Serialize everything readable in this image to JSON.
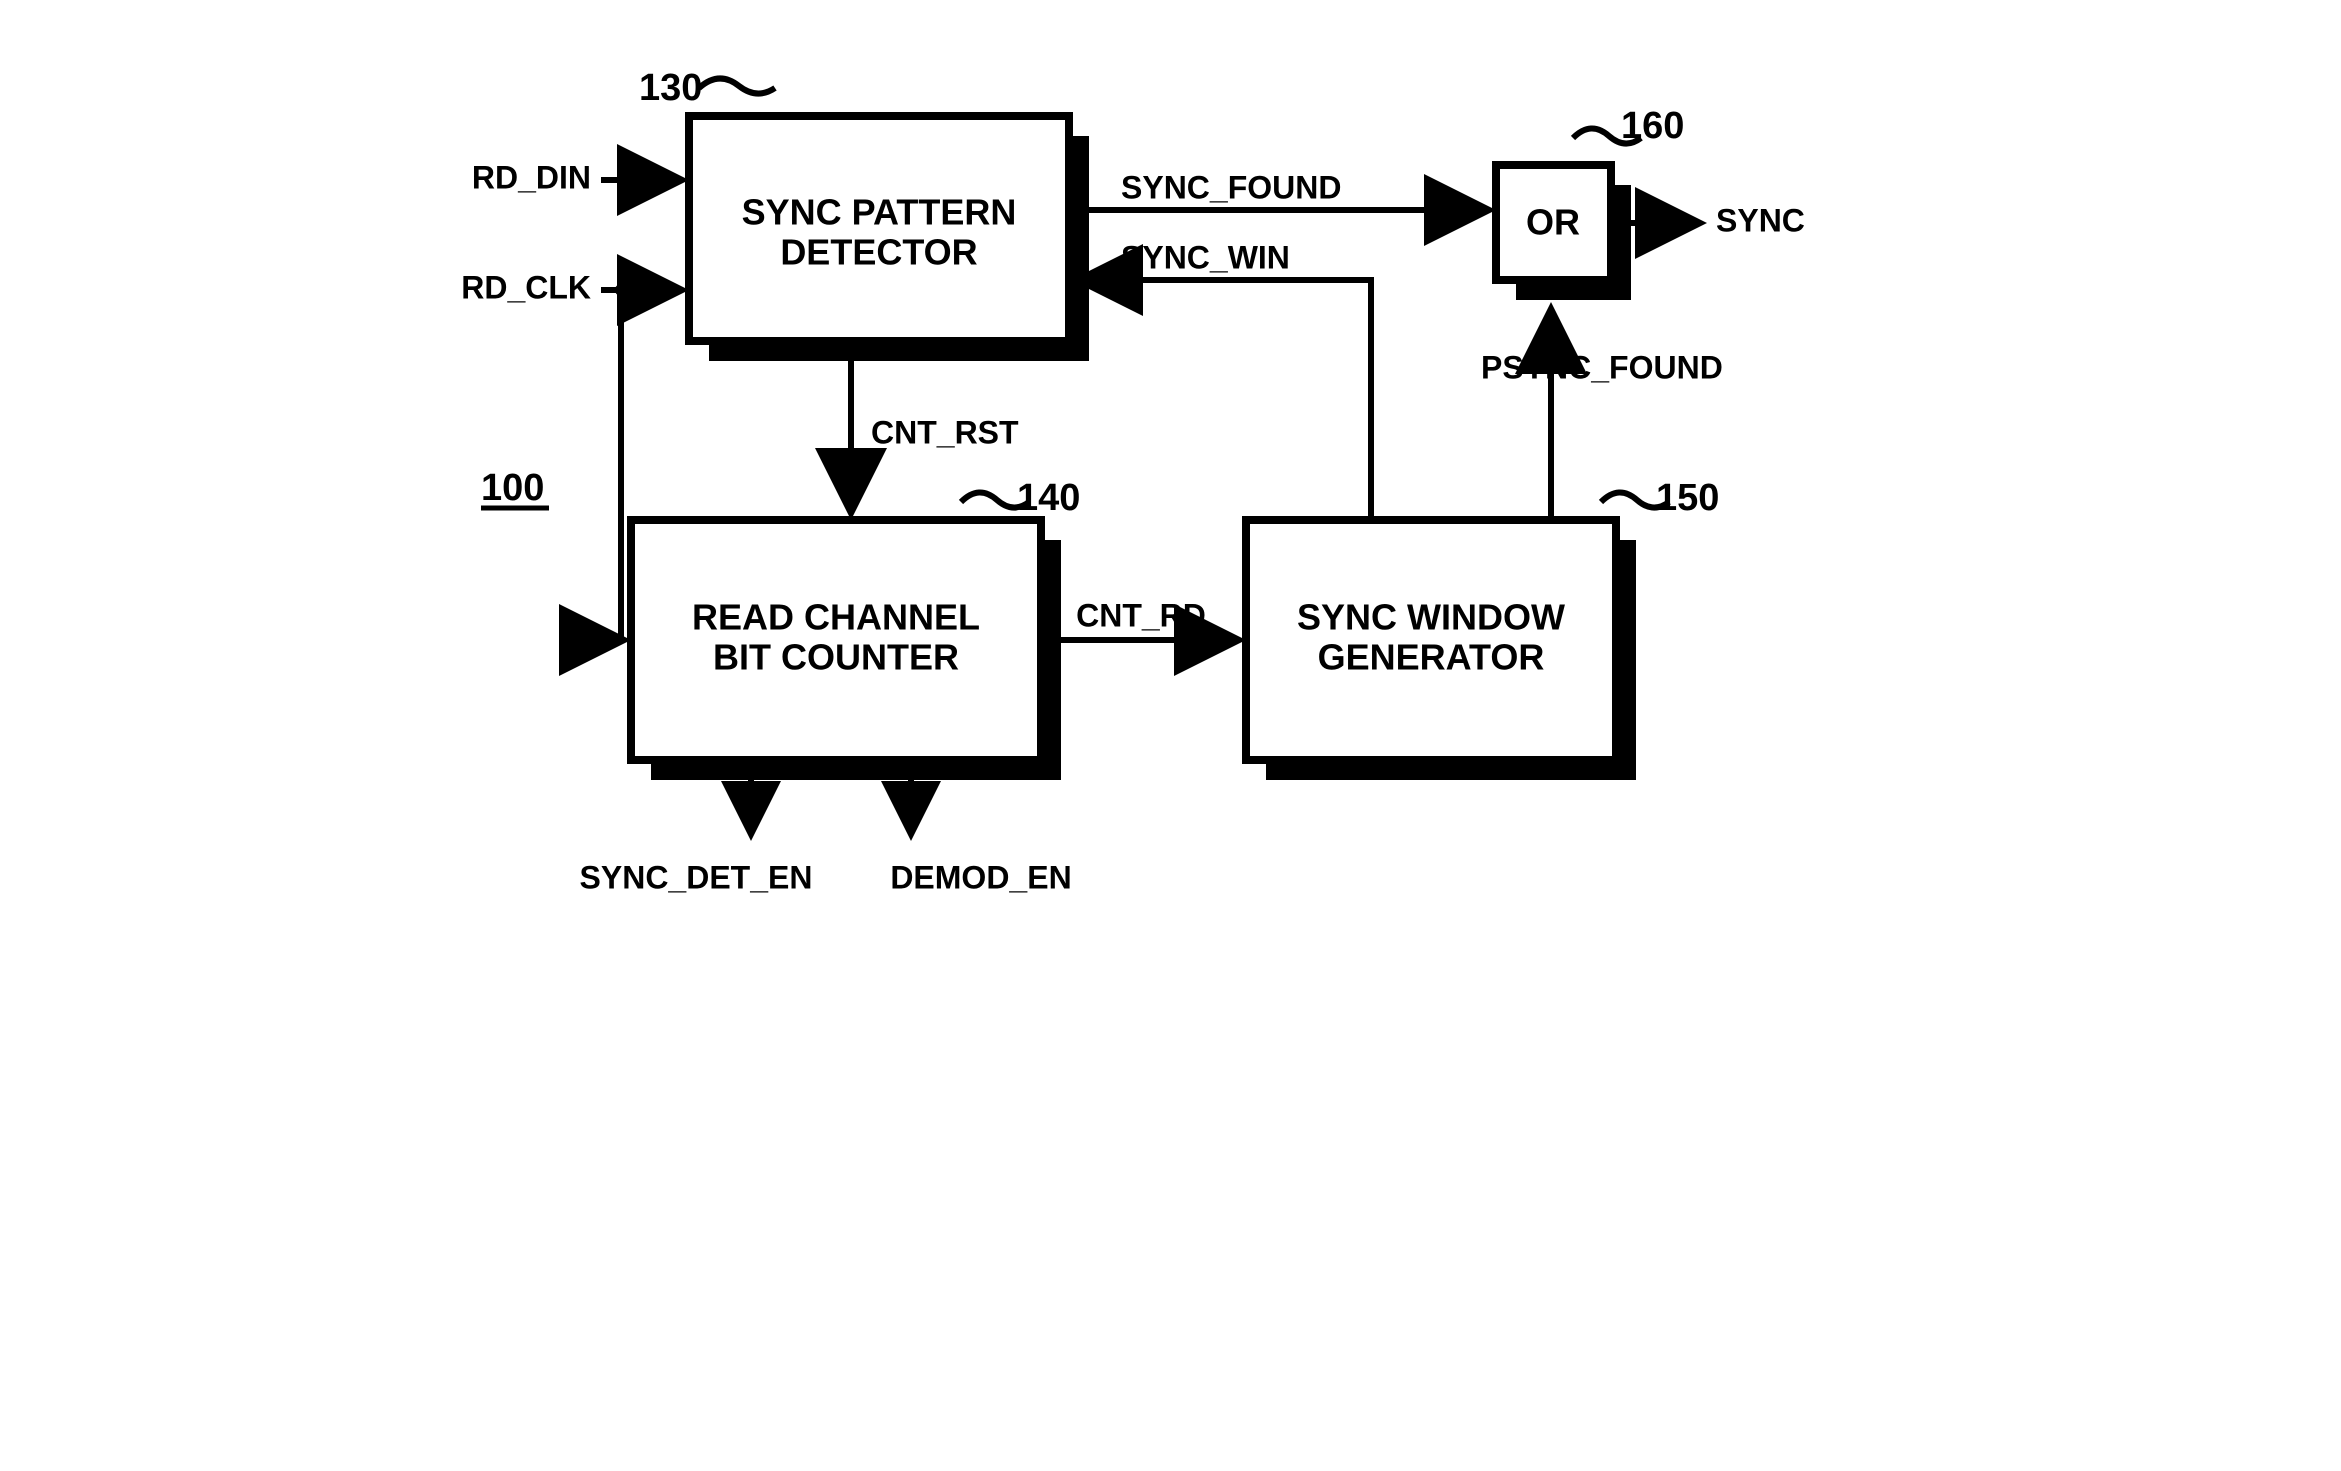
{
  "ref": {
    "fig": "100",
    "spd": "130",
    "rcbc": "140",
    "swg": "150",
    "org": "160"
  },
  "block": {
    "spd": [
      "SYNC PATTERN",
      "DETECTOR"
    ],
    "rcbc": [
      "READ CHANNEL",
      "BIT COUNTER"
    ],
    "swg": [
      "SYNC WINDOW",
      "GENERATOR"
    ],
    "org": "OR"
  },
  "sig": {
    "rd_din": "RD_DIN",
    "rd_clk": "RD_CLK",
    "sync_found": "SYNC_FOUND",
    "sync_win": "SYNC_WIN",
    "cnt_rst": "CNT_RST",
    "cnt_rd": "CNT_RD",
    "psync_found": "PSYNC_FOUND",
    "sync": "SYNC",
    "sync_det_en": "SYNC_DET_EN",
    "demod_en": "DEMOD_EN"
  }
}
